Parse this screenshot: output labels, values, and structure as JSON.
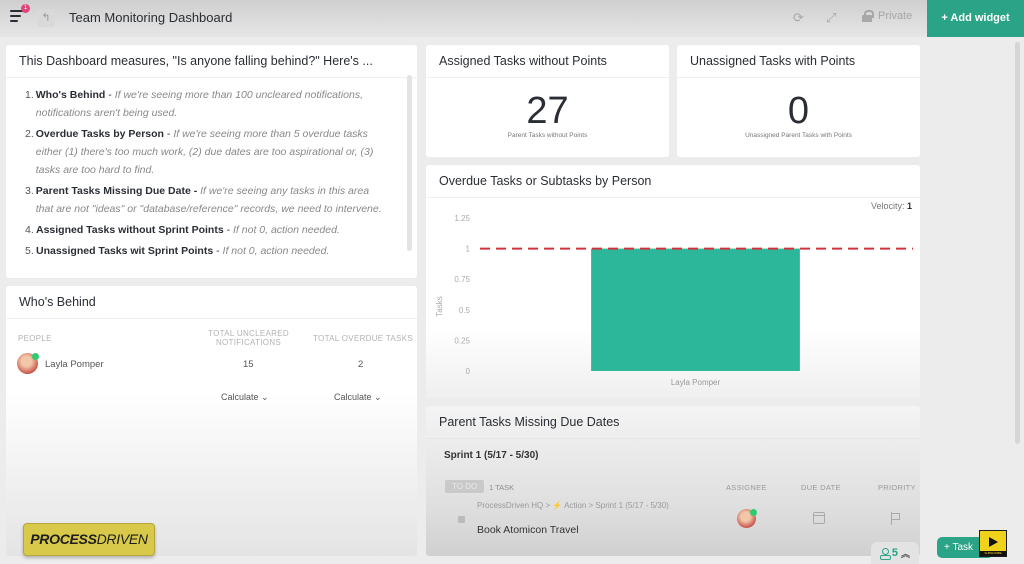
{
  "topbar": {
    "title": "Team Monitoring Dashboard",
    "notification_count": "1",
    "privacy_label": "Private",
    "add_widget_label": "+ Add widget"
  },
  "description_card": {
    "title": "This Dashboard measures, \"Is anyone falling behind?\" Here's ...",
    "items": [
      {
        "num": "1.",
        "bold": "Who's Behind",
        "sep": " - ",
        "italic": "If we're seeing more than 100 uncleared notifications, notifications aren't being used."
      },
      {
        "num": "2.",
        "bold": "Overdue Tasks by Person",
        "sep": " - ",
        "italic": "If we're seeing more than 5 overdue tasks either (1) there's too much work, (2) due dates are too aspirational or, (3) tasks are too hard to find."
      },
      {
        "num": "3.",
        "bold": "Parent Tasks Missing Due Date -",
        "sep": " ",
        "italic": "If we're seeing any tasks in this area that are not \"ideas\" or \"database/reference\" records, we need to intervene."
      },
      {
        "num": "4.",
        "bold": "Assigned Tasks without Sprint Points",
        "sep": " - ",
        "italic": "If not 0, action needed."
      },
      {
        "num": "5.",
        "bold": "Unassigned Tasks wit Sprint Points",
        "sep": " - ",
        "italic": "If not 0, action needed."
      }
    ]
  },
  "whos_behind": {
    "title": "Who's Behind",
    "columns": [
      "PEOPLE",
      "TOTAL UNCLEARED NOTIFICATIONS",
      "TOTAL OVERDUE TASKS"
    ],
    "rows": [
      {
        "name": "Layla Pomper",
        "uncleared": "15",
        "overdue": "2"
      }
    ],
    "footer": [
      "Calculate",
      "Calculate"
    ]
  },
  "assigned_card": {
    "title": "Assigned Tasks without Points",
    "value": "27",
    "subtitle": "Parent Tasks without Points"
  },
  "unassigned_card": {
    "title": "Unassigned Tasks with Points",
    "value": "0",
    "subtitle": "Unassigned Parent Tasks with Points"
  },
  "overdue_chart": {
    "title": "Overdue Tasks or Subtasks by Person",
    "velocity_label": "Velocity:",
    "velocity_value": "1"
  },
  "chart_data": {
    "type": "bar",
    "title": "Overdue Tasks or Subtasks by Person",
    "categories": [
      "Layla Pomper"
    ],
    "values": [
      1
    ],
    "xlabel": "",
    "ylabel": "Tasks",
    "ylim": [
      0,
      1.25
    ],
    "yticks": [
      0,
      0.25,
      0.5,
      0.75,
      1,
      1.25
    ],
    "reference_line": {
      "value": 1,
      "label": "Velocity",
      "style": "dashed",
      "color": "#d63040"
    },
    "bar_color": "#2db79a",
    "grid": false
  },
  "parent_tasks": {
    "title": "Parent Tasks Missing Due Dates",
    "sprint": "Sprint 1 (5/17 - 5/30)",
    "status": "TO DO",
    "task_count": "1 TASK",
    "columns": [
      "ASSIGNEE",
      "DUE DATE",
      "PRIORITY"
    ],
    "tasks": [
      {
        "breadcrumb": "ProcessDriven HQ  >  ⚡ Action  >  Sprint 1 (5/17 - 5/30)",
        "name": "Book Atomicon Travel"
      }
    ]
  },
  "overlay": {
    "logo_bold": "PROCESS",
    "logo_light": "DRIVEN",
    "people_count": "5",
    "task_button": "+ Task",
    "subscribe": "SUBSCRIBE"
  },
  "colors": {
    "accent": "#2aa386",
    "bar": "#2db79a",
    "reference_line": "#d63040",
    "notification": "#e0447c"
  }
}
